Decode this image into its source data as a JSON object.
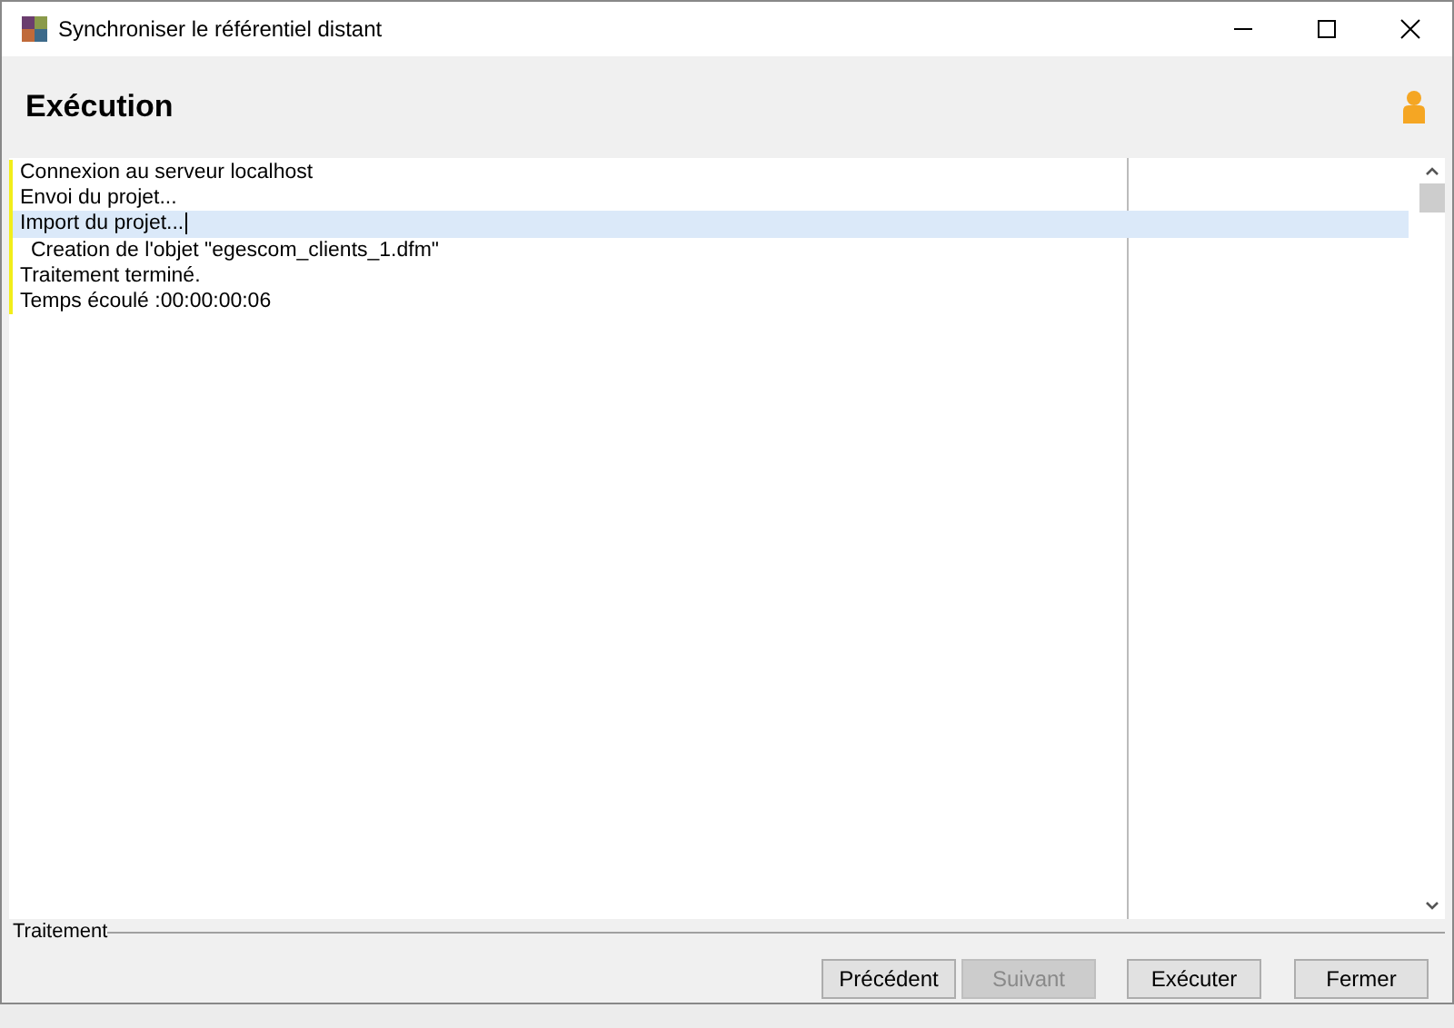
{
  "window": {
    "title": "Synchroniser le référentiel distant"
  },
  "header": {
    "title": "Exécution"
  },
  "log": [
    {
      "text": "Connexion au serveur localhost",
      "selected": false
    },
    {
      "text": "Envoi du projet...",
      "selected": false
    },
    {
      "text": "Import du projet...",
      "selected": true,
      "children": [
        {
          "text": "Creation de l'objet \"egescom_clients_1.dfm\"",
          "selected": false
        }
      ]
    },
    {
      "text": "Traitement terminé.",
      "selected": false
    },
    {
      "text": "Temps écoulé :00:00:00:06",
      "selected": false
    }
  ],
  "footer": {
    "label": "Traitement"
  },
  "buttons": [
    {
      "label": "Précédent",
      "disabled": false
    },
    {
      "label": "Suivant",
      "disabled": true
    },
    {
      "label": "Exécuter",
      "disabled": false
    },
    {
      "label": "Fermer",
      "disabled": false
    }
  ]
}
